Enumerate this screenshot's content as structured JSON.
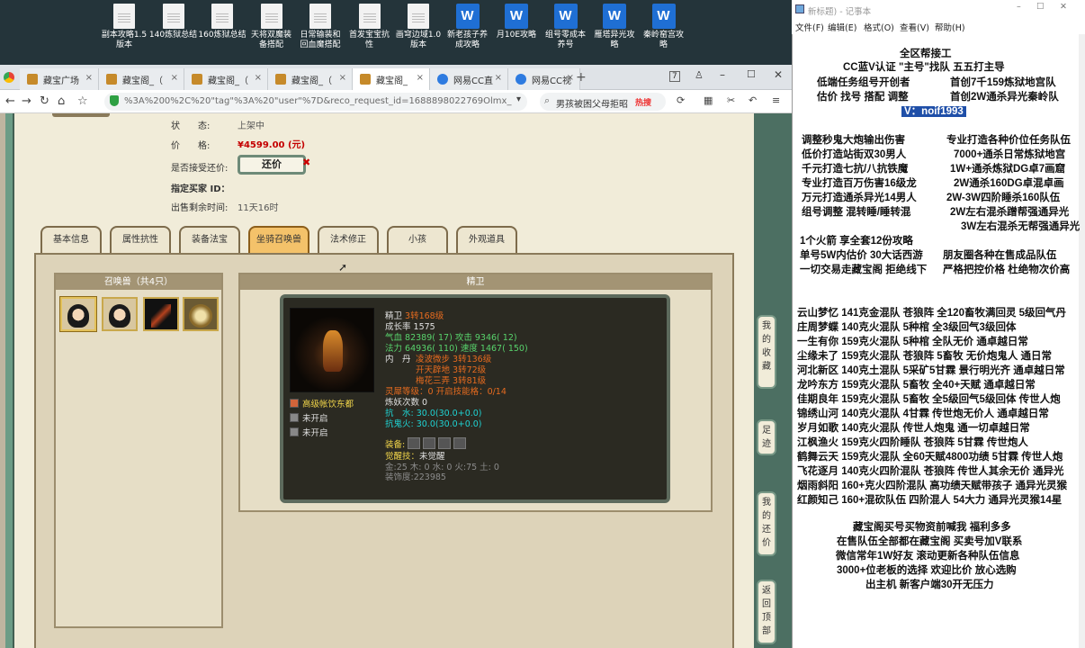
{
  "desktop": {
    "icons": [
      {
        "type": "doc",
        "label": "副本攻略1.5 版本"
      },
      {
        "type": "doc",
        "label": "140炼狱总结"
      },
      {
        "type": "doc",
        "label": "160炼狱总结"
      },
      {
        "type": "doc",
        "label": "天将双魔装 备搭配"
      },
      {
        "type": "doc",
        "label": "日常输装和 回血魔搭配"
      },
      {
        "type": "doc",
        "label": "首发宝宝抗 性"
      },
      {
        "type": "doc",
        "label": "画穹边域1.0 版本"
      },
      {
        "type": "wps",
        "label": "新老孩子养 成攻略"
      },
      {
        "type": "wps",
        "label": "月10E攻略"
      },
      {
        "type": "wps",
        "label": "组号零成本 养号"
      },
      {
        "type": "wps",
        "label": "雁塔异光攻 略"
      },
      {
        "type": "wps",
        "label": "秦岭窑宫攻 略"
      }
    ]
  },
  "browser": {
    "tabs": [
      {
        "label": "藏宝广场"
      },
      {
        "label": "藏宝阁_（"
      },
      {
        "label": "藏宝阁_（"
      },
      {
        "label": "藏宝阁_（"
      },
      {
        "label": "藏宝阁_"
      },
      {
        "label": "网易CC直"
      },
      {
        "label": "网易CC视"
      }
    ],
    "tab_count": "7",
    "url": "%3A%200%2C%20\"tag\"%3A%20\"user\"%7D&reco_request_id=1688898022769Olmx_",
    "search": "男孩被困父母拒昭",
    "hot": "热搜"
  },
  "listing": {
    "status_label": "状　　态:",
    "status_value": "上架中",
    "price_label": "价　　格:",
    "price_value": "¥4599.00 (元)",
    "haggle_label": "是否接受还价:",
    "haggle_button": "还价",
    "buyer_label": "指定买家 ID：",
    "remaining_label": "出售剩余时间:",
    "remaining_value": "11天16时"
  },
  "tabs": [
    "基本信息",
    "属性抗性",
    "装备法宝",
    "坐骑召唤兽",
    "法术修正",
    "小孩",
    "外观道具"
  ],
  "summons": {
    "header": "召唤兽（共4只）"
  },
  "detail": {
    "header": "精卫",
    "name": "精卫",
    "name_rank": "3转168级",
    "growth": "成长率 1575",
    "hp_label": "气血",
    "hp": "82389( 17)",
    "atk_label": "攻击",
    "atk": "9346( 12)",
    "mp_label": "法力",
    "mp": "64936( 110)",
    "spd_label": "速度",
    "spd": "1467( 150)",
    "neidan_label": "内　丹",
    "neidan": [
      "凌波微步 3转136级",
      "开天辟地 3转72级",
      "梅花三弄 3转81级"
    ],
    "spirit": "灵犀等级：0 开启技能格：0/14",
    "refine": "炼妖次数 0",
    "res_water": "抗　水: 30.0(30.0+0.0)",
    "res_ghost": "抗鬼火: 30.0(30.0+0.0)",
    "equip_label": "装备:",
    "awaken": "觉醒技：",
    "awaken_value": "未觉醒",
    "elements": "金:25 木: 0 水: 0 火:75 土: 0",
    "collect": "装饰度:223985",
    "skills": [
      "高级帐饮东都",
      "未开启",
      "未开启"
    ]
  },
  "vertical_buttons": [
    "我的收藏",
    "足迹",
    "我的还价",
    "返回顶部"
  ],
  "notepad": {
    "title": "新标题) - 记事本",
    "menu": [
      "文件(F)",
      "编辑(E)",
      "格式(O)",
      "查看(V)",
      "帮助(H)"
    ],
    "head": [
      "全区帮接工",
      "CC蓝V认证 \"主号\"找队 五五打主导",
      "低端任务组号开创者",
      "首创7千159炼狱地宫队",
      "估价 找号 搭配 调整",
      "首创2W通杀异光秦岭队",
      "V：noif1993"
    ],
    "services_left": [
      "调整秒鬼大炮输出伤害",
      "低价打造站街双30男人",
      "千元打造七抗/八抗铁魔",
      "专业打造百万伤害16级龙",
      "万元打造通杀异光14男人",
      "组号调整 混转睡/睡转混"
    ],
    "services_right": [
      "专业打造各种价位任务队伍",
      "7000+通杀日常炼狱地宫",
      "1W+通杀炼狱DG卓7画窟",
      "2W通杀160DG卓混卓画",
      "2W-3W四阶睡杀160队伍",
      "2W左右混杀蹭帮强通异光",
      "3W左右混杀无帮强通异光"
    ],
    "promo_left": [
      "1个火箭 享全套12份攻略",
      "单号5W内估价 30大话西游",
      "一切交易走藏宝阁 拒绝线下"
    ],
    "promo_right": [
      "朋友圈各种在售成品队伍",
      "严格把控价格 杜绝物次价高"
    ],
    "teams": [
      "云山梦忆 141克金混队 苍狼阵 全120畜牧满回灵 5级回气丹",
      "庄周梦蝶 140克火混队 5种棺 全3级回气3级回体",
      "一生有你 159克火混队 5种棺 全队无价 通卓越日常",
      "尘缘未了 159克火混队 苍狼阵 5畜牧 无价炮鬼人 通日常",
      "河北新区 140克土混队 5采矿5甘霖 景行明光齐 通卓越日常",
      "龙吟东方 159克火混队 5畜牧 全40+天赋 通卓越日常",
      "佳期良年 159克火混队 5畜牧 全5级回气5级回体 传世人炮",
      "锦绣山河 140克火混队 4甘霖 传世炮无价人 通卓越日常",
      "岁月如歌 140克火混队 传世人炮鬼 通一切卓越日常",
      "江枫渔火 159克火四阶睡队 苍狼阵 5甘霖 传世炮人",
      "鹤舞云天 159克火混队 全60天赋4800功绩 5甘霖 传世人炮",
      "飞花逐月 140克火四阶混队 苍狼阵 传世人其余无价 通异光",
      "烟雨斜阳 160+克火四阶混队 高功绩天赋带孩子 通异光灵猴",
      "红颜知己 160+混砍队伍 四阶混人 54大力 通异光灵猴14星"
    ],
    "footer": [
      "藏宝阁买号买物资前喊我 福利多多",
      "在售队伍全部都在藏宝阁 买卖号加V联系",
      "微信常年1W好友 滚动更新各种队伍信息",
      "3000+位老板的选择 欢迎比价 放心选购",
      "出主机 新客户端30开无压力"
    ]
  }
}
